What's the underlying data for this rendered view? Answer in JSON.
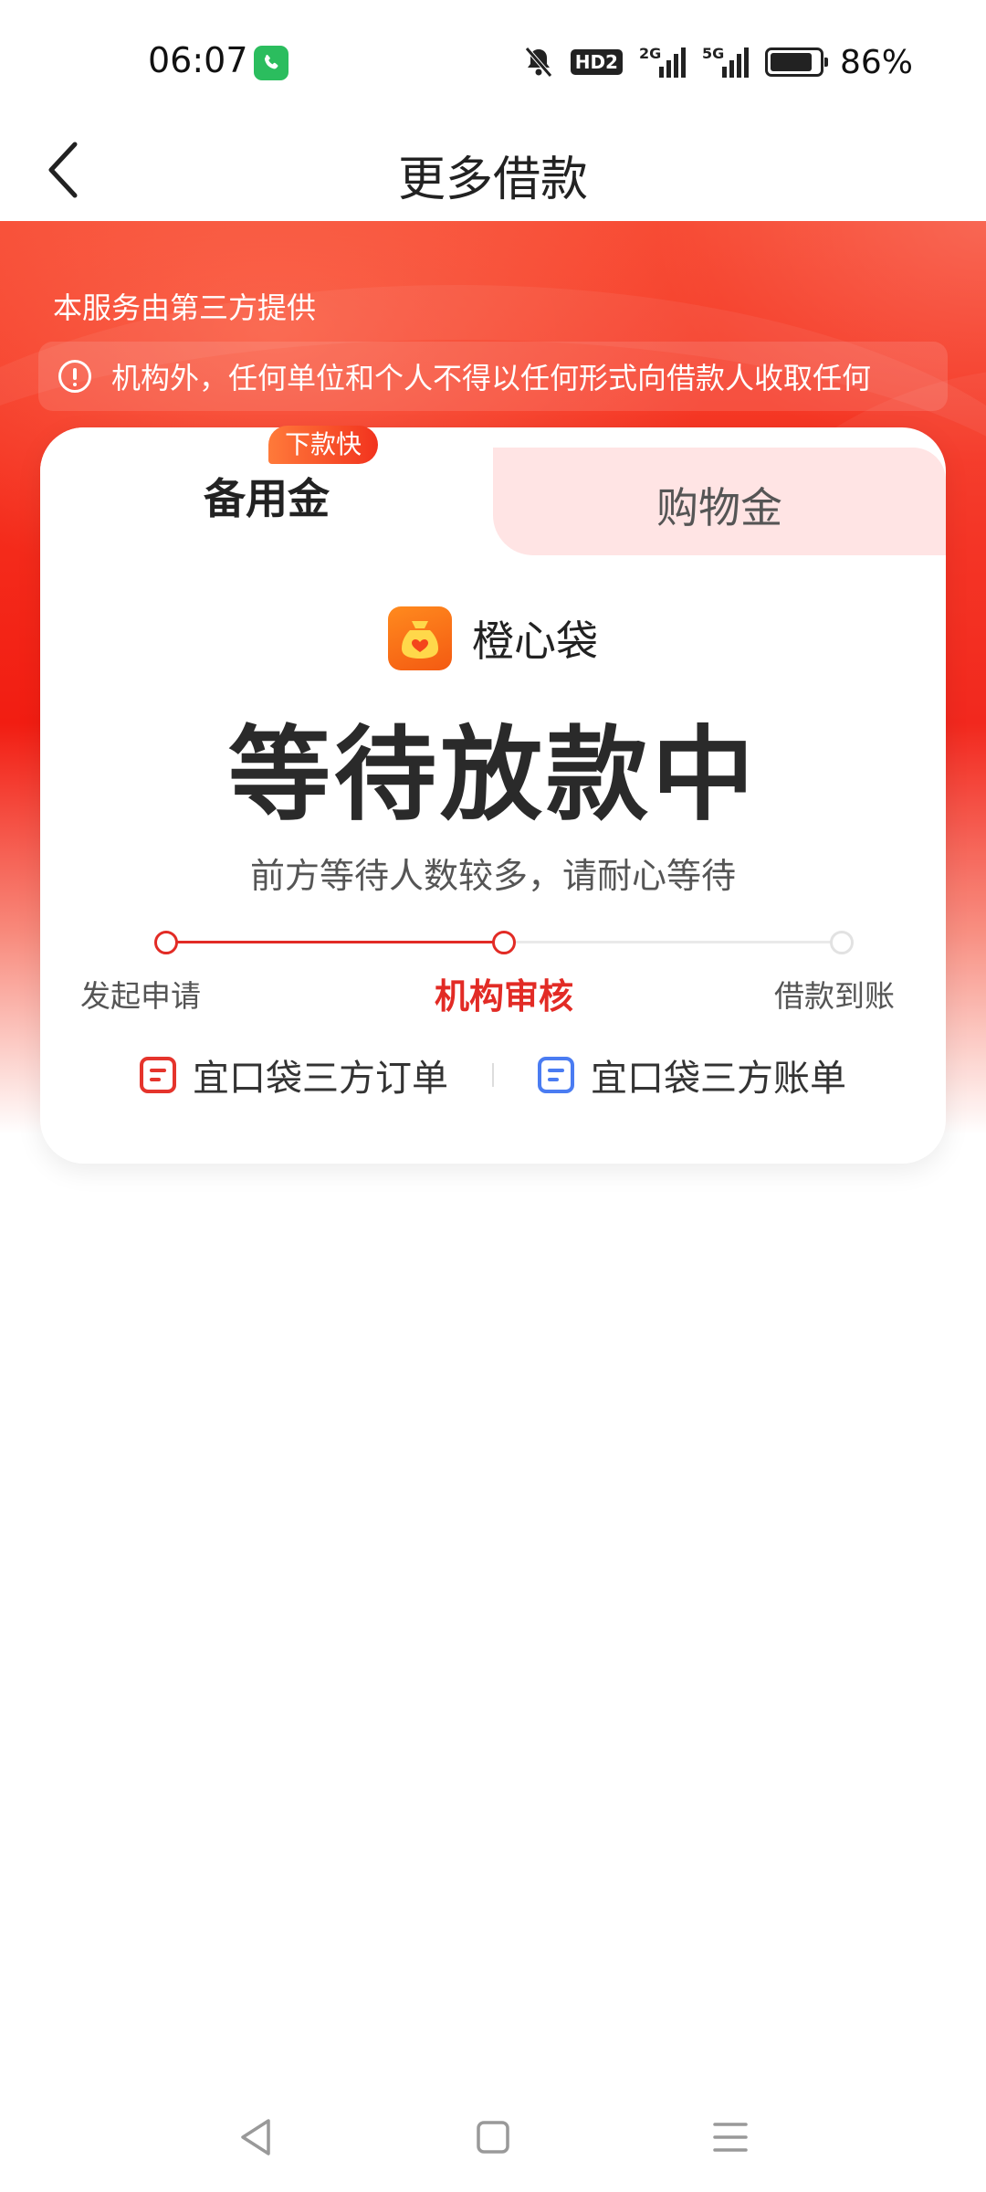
{
  "status_bar": {
    "time": "06:07",
    "hd_label": "HD2",
    "signal1_label": "2G",
    "signal2_label": "5G",
    "battery_percent": "86%",
    "battery_level": 0.86
  },
  "header": {
    "title": "更多借款"
  },
  "banner": {
    "provider_text": "本服务由第三方提供",
    "notice_text": "机构外，任何单位和个人不得以任何形式向借款人收取任何"
  },
  "tabs": {
    "left_label": "备用金",
    "left_badge": "下款快",
    "right_label": "购物金"
  },
  "brand": {
    "name": "橙心袋"
  },
  "loan_status": {
    "title": "等待放款中",
    "subtitle": "前方等待人数较多，请耐心等待"
  },
  "progress": {
    "steps": [
      {
        "label": "发起申请"
      },
      {
        "label": "机构审核"
      },
      {
        "label": "借款到账"
      }
    ],
    "current_step": 2
  },
  "links": {
    "order_label": "宜口袋三方订单",
    "bill_label": "宜口袋三方账单"
  },
  "colors": {
    "accent_red": "#e22b25",
    "blue_icon": "#4a7cf2",
    "tab_inactive_bg": "#ffe4e4"
  }
}
